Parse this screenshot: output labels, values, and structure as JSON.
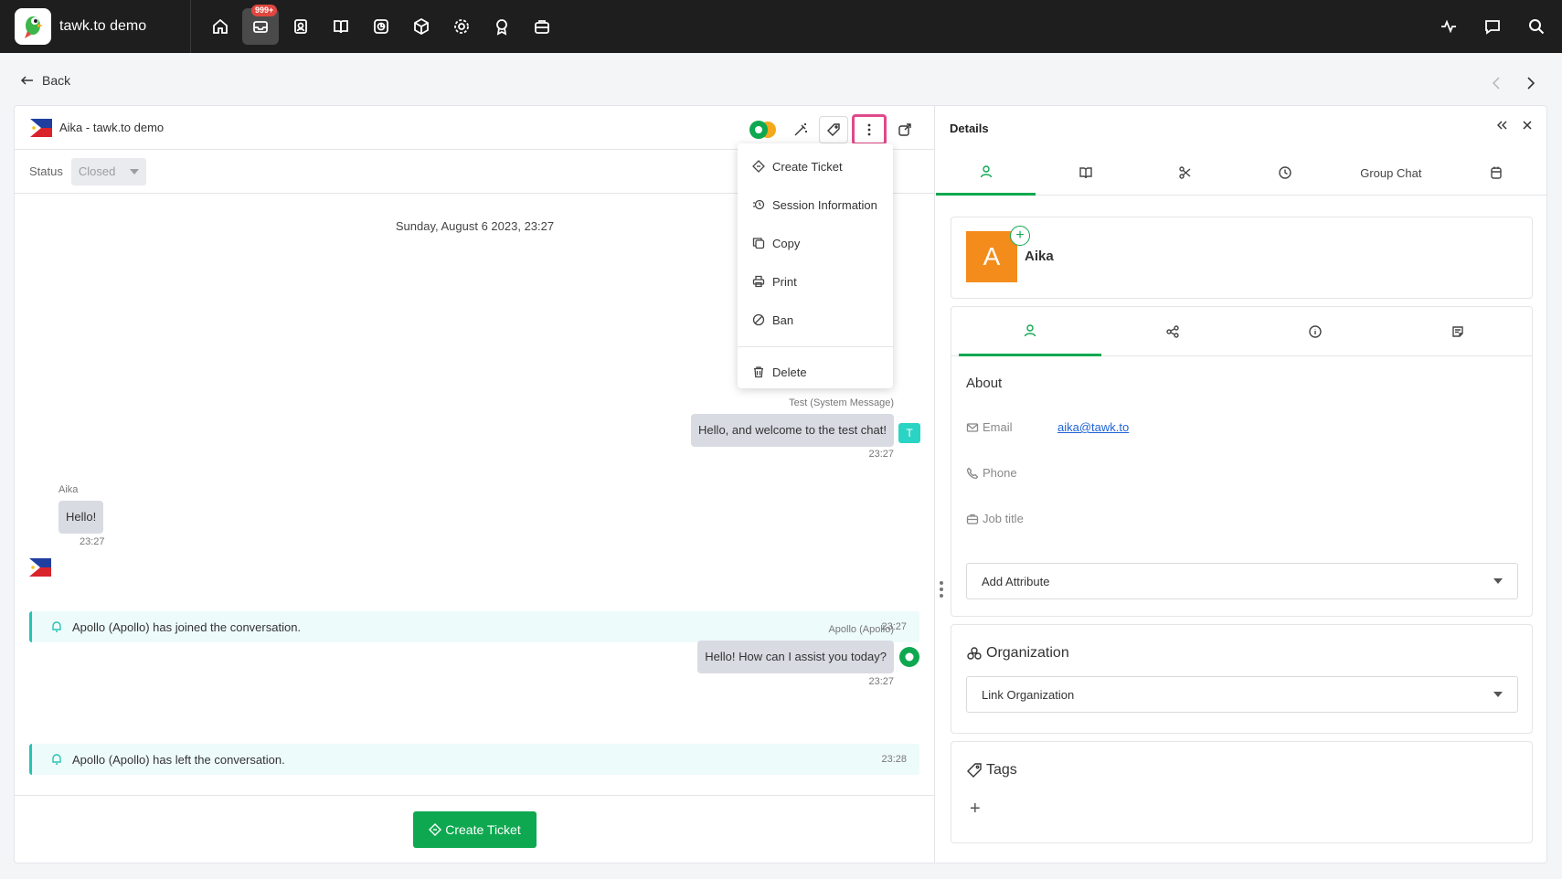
{
  "app": {
    "name": "tawk.to demo",
    "badge": "999+"
  },
  "back_label": "Back",
  "chat": {
    "title": "Aika - tawk.to demo",
    "status_label": "Status",
    "status_value": "Closed",
    "date": "Sunday, August 6 2023, 23:27",
    "messages": [
      {
        "sender": "Test (System Message)",
        "text": "Hello, and welcome to the test chat!",
        "time": "23:27",
        "avatar": "T"
      },
      {
        "sender": "Aika",
        "text": "Hello!",
        "time": "23:27"
      },
      {
        "sender": "Apollo (Apollo)",
        "text": "Hello! How can I assist you today?",
        "time": "23:27"
      }
    ],
    "system_events": [
      {
        "text": "Apollo (Apollo) has joined the conversation.",
        "time": "23:27"
      },
      {
        "text": "Apollo (Apollo) has left the conversation.",
        "time": "23:28"
      }
    ],
    "create_ticket": "Create Ticket"
  },
  "menu": {
    "items": [
      "Create Ticket",
      "Session Information",
      "Copy",
      "Print",
      "Ban"
    ],
    "delete": "Delete"
  },
  "details": {
    "title": "Details",
    "group_chat": "Group Chat",
    "contact_initial": "A",
    "contact_name": "Aika",
    "about": "About",
    "email_label": "Email",
    "email_value": "aika@tawk.to",
    "phone_label": "Phone",
    "job_label": "Job title",
    "add_attribute": "Add Attribute",
    "organization": "Organization",
    "link_org": "Link Organization",
    "tags": "Tags",
    "add_tag": "+"
  },
  "colors": {
    "accent": "#0ea850",
    "avatar": "#f48c1c",
    "highlight": "#e04a8a",
    "topbar": "#1e1e1e"
  }
}
